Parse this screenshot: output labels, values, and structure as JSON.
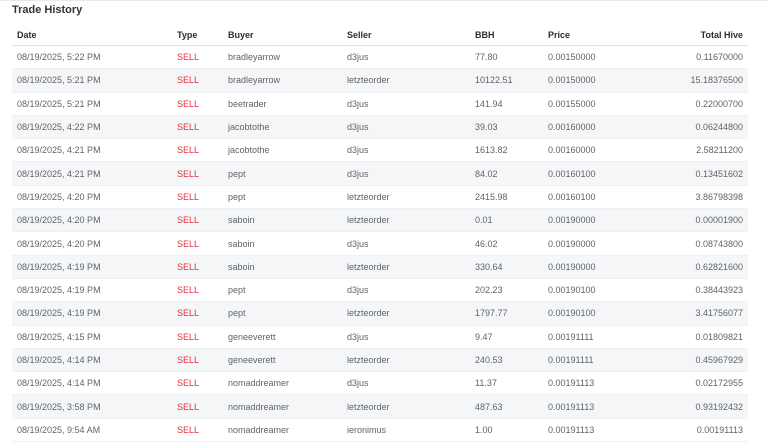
{
  "title": "Trade History",
  "columns": [
    "Date",
    "Type",
    "Buyer",
    "Seller",
    "BBH",
    "Price",
    "Total Hive"
  ],
  "colors": {
    "sell": "#e0313c",
    "stripe": "#f5f6f8"
  },
  "rows": [
    {
      "date": "08/19/2025, 5:22 PM",
      "type": "SELL",
      "buyer": "bradleyarrow",
      "seller": "d3jus",
      "bbh": "77.80",
      "price": "0.00150000",
      "total": "0.11670000"
    },
    {
      "date": "08/19/2025, 5:21 PM",
      "type": "SELL",
      "buyer": "bradleyarrow",
      "seller": "letzteorder",
      "bbh": "10122.51",
      "price": "0.00150000",
      "total": "15.18376500"
    },
    {
      "date": "08/19/2025, 5:21 PM",
      "type": "SELL",
      "buyer": "beetrader",
      "seller": "d3jus",
      "bbh": "141.94",
      "price": "0.00155000",
      "total": "0.22000700"
    },
    {
      "date": "08/19/2025, 4:22 PM",
      "type": "SELL",
      "buyer": "jacobtothe",
      "seller": "d3jus",
      "bbh": "39.03",
      "price": "0.00160000",
      "total": "0.06244800"
    },
    {
      "date": "08/19/2025, 4:21 PM",
      "type": "SELL",
      "buyer": "jacobtothe",
      "seller": "d3jus",
      "bbh": "1613.82",
      "price": "0.00160000",
      "total": "2.58211200"
    },
    {
      "date": "08/19/2025, 4:21 PM",
      "type": "SELL",
      "buyer": "pept",
      "seller": "d3jus",
      "bbh": "84.02",
      "price": "0.00160100",
      "total": "0.13451602"
    },
    {
      "date": "08/19/2025, 4:20 PM",
      "type": "SELL",
      "buyer": "pept",
      "seller": "letzteorder",
      "bbh": "2415.98",
      "price": "0.00160100",
      "total": "3.86798398"
    },
    {
      "date": "08/19/2025, 4:20 PM",
      "type": "SELL",
      "buyer": "saboin",
      "seller": "letzteorder",
      "bbh": "0.01",
      "price": "0.00190000",
      "total": "0.00001900"
    },
    {
      "date": "08/19/2025, 4:20 PM",
      "type": "SELL",
      "buyer": "saboin",
      "seller": "d3jus",
      "bbh": "46.02",
      "price": "0.00190000",
      "total": "0.08743800"
    },
    {
      "date": "08/19/2025, 4:19 PM",
      "type": "SELL",
      "buyer": "saboin",
      "seller": "letzteorder",
      "bbh": "330.64",
      "price": "0.00190000",
      "total": "0.62821600"
    },
    {
      "date": "08/19/2025, 4:19 PM",
      "type": "SELL",
      "buyer": "pept",
      "seller": "d3jus",
      "bbh": "202.23",
      "price": "0.00190100",
      "total": "0.38443923"
    },
    {
      "date": "08/19/2025, 4:19 PM",
      "type": "SELL",
      "buyer": "pept",
      "seller": "letzteorder",
      "bbh": "1797.77",
      "price": "0.00190100",
      "total": "3.41756077"
    },
    {
      "date": "08/19/2025, 4:15 PM",
      "type": "SELL",
      "buyer": "geneeverett",
      "seller": "d3jus",
      "bbh": "9.47",
      "price": "0.00191111",
      "total": "0.01809821"
    },
    {
      "date": "08/19/2025, 4:14 PM",
      "type": "SELL",
      "buyer": "geneeverett",
      "seller": "letzteorder",
      "bbh": "240.53",
      "price": "0.00191111",
      "total": "0.45967929"
    },
    {
      "date": "08/19/2025, 4:14 PM",
      "type": "SELL",
      "buyer": "nomaddreamer",
      "seller": "d3jus",
      "bbh": "11.37",
      "price": "0.00191113",
      "total": "0.02172955"
    },
    {
      "date": "08/19/2025, 3:58 PM",
      "type": "SELL",
      "buyer": "nomaddreamer",
      "seller": "letzteorder",
      "bbh": "487.63",
      "price": "0.00191113",
      "total": "0.93192432"
    },
    {
      "date": "08/19/2025, 9:54 AM",
      "type": "SELL",
      "buyer": "nomaddreamer",
      "seller": "ieronimus",
      "bbh": "1.00",
      "price": "0.00191113",
      "total": "0.00191113"
    }
  ]
}
